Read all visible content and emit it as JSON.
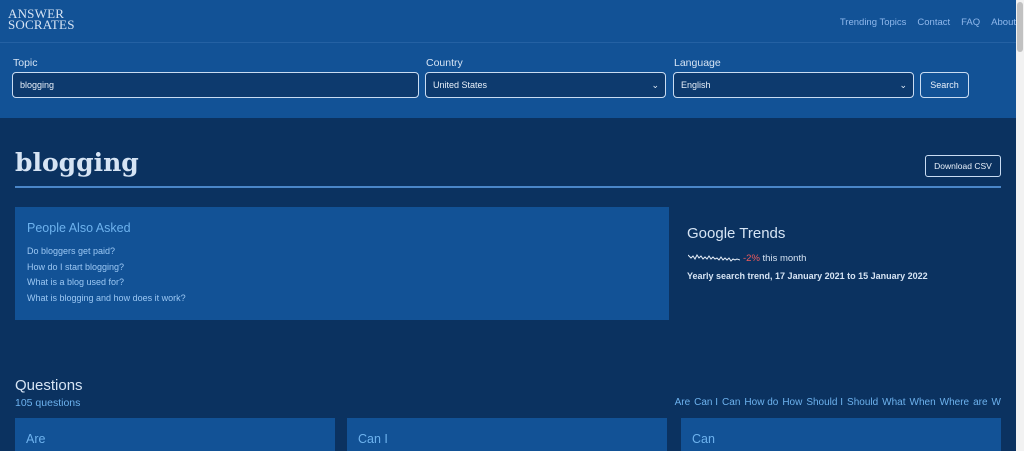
{
  "logo": {
    "line1": "ANSWER",
    "line2": "SOCRATES"
  },
  "nav": [
    "Trending Topics",
    "Contact",
    "FAQ",
    "About"
  ],
  "search_bar": {
    "topic_label": "Topic",
    "topic_value": "blogging",
    "country_label": "Country",
    "country_value": "United States",
    "language_label": "Language",
    "language_value": "English",
    "search_button": "Search"
  },
  "page": {
    "title": "blogging",
    "download_button": "Download CSV"
  },
  "people_also_asked": {
    "heading": "People Also Asked",
    "questions": [
      "Do bloggers get paid?",
      "How do I start blogging?",
      "What is a blog used for?",
      "What is blogging and how does it work?"
    ]
  },
  "google_trends": {
    "heading": "Google Trends",
    "change": "-2%",
    "change_suffix": "this month",
    "range": "Yearly search trend, 17 January 2021 to 15 January 2022",
    "change_color": "#f25b5b"
  },
  "questions": {
    "heading": "Questions",
    "count": "105 questions",
    "filters": [
      "Are",
      "Can I",
      "Can",
      "How do",
      "How",
      "Should I",
      "Should",
      "What",
      "When",
      "Where",
      "are",
      "W"
    ],
    "cards": [
      "Are",
      "Can I",
      "Can"
    ]
  },
  "colors": {
    "header_bg": "#125296",
    "page_bg": "#0b3260",
    "accent": "#6db2ee"
  }
}
